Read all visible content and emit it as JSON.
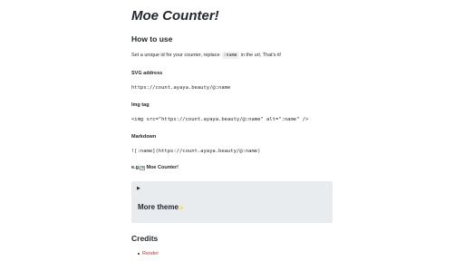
{
  "page": {
    "title": "Moe Counter!"
  },
  "how_to_use": {
    "heading": "How to use",
    "intro_before": "Set a unique id for your counter, replace",
    "intro_code": ":name",
    "intro_after": "in the url, That's it!",
    "svg_label": "SVG address",
    "svg_code": "https://count.ayaya.beauty/@:name",
    "img_label": "Img tag",
    "img_code": "<img src=\"https://count.ayaya.beauty/@:name\" alt=\":name\" />",
    "md_label": "Markdown",
    "md_code": "![:name](https://count.ayaya.beauty/@:name)",
    "example_prefix": "e.g.",
    "example_alt": "Moe Counter!"
  },
  "themes": {
    "toggle_icon": "▶",
    "title": "More theme",
    "sparkle": "✨"
  },
  "credits": {
    "heading": "Credits",
    "items": [
      {
        "label": "Render"
      }
    ]
  },
  "colors": {
    "link": "#c0392b",
    "details_bg": "#e9ecef",
    "text": "#24292e"
  }
}
